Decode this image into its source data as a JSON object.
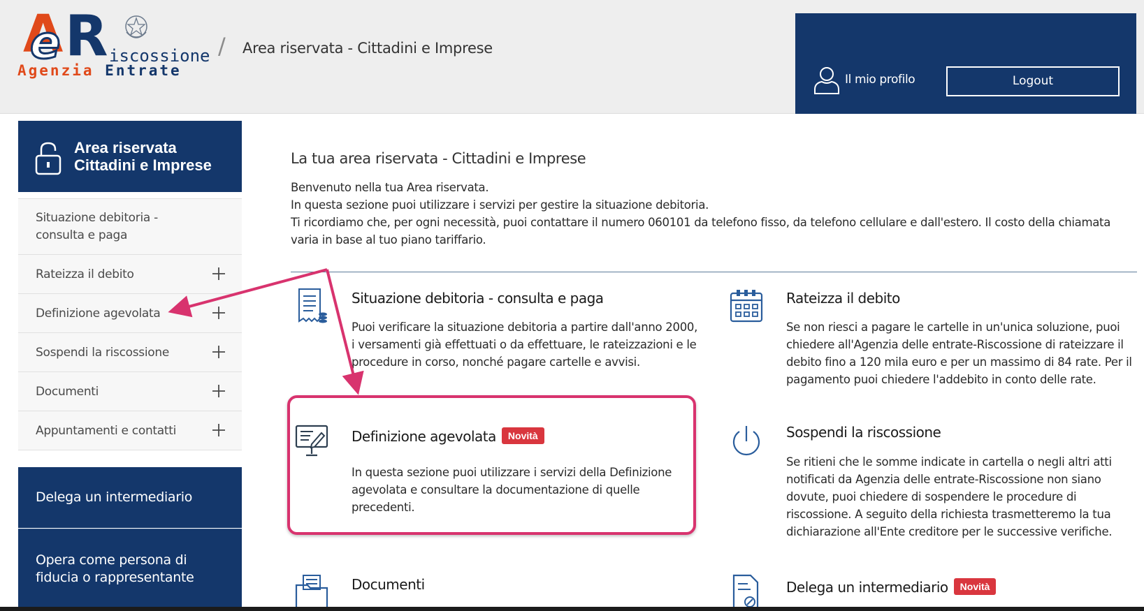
{
  "header": {
    "logo": {
      "mark_letters": "eR",
      "suffix": "iscossione",
      "agency_word1": "Agenzia",
      "agency_word2": "Entrate",
      "emblem_icon": "italian-republic-emblem"
    },
    "breadcrumb_separator": "/",
    "breadcrumb_title": "Area riservata - Cittadini e Imprese",
    "profile_label": "Il mio profilo",
    "profile_icon": "user-icon",
    "logout_label": "Logout"
  },
  "sidebar": {
    "header_title_line1": "Area riservata",
    "header_title_line2": "Cittadini e Imprese",
    "header_icon": "lock-open-icon",
    "items": [
      {
        "label": "Situazione debitoria - consulta e paga",
        "expandable": false
      },
      {
        "label": "Rateizza il debito",
        "expandable": true
      },
      {
        "label": "Definizione agevolata",
        "expandable": true
      },
      {
        "label": "Sospendi la riscossione",
        "expandable": true
      },
      {
        "label": "Documenti",
        "expandable": true
      },
      {
        "label": "Appuntamenti e contatti",
        "expandable": true
      }
    ],
    "delegate_button": "Delega un intermediario",
    "trusted_person_button": "Opera come persona di fiducia o rappresentante"
  },
  "main": {
    "title": "La tua area riservata - Cittadini e Imprese",
    "intro": [
      "Benvenuto nella tua Area riservata.",
      "In questa sezione puoi utilizzare i servizi per gestire la situazione debitoria.",
      "Ti ricordiamo che, per ogni necessità, puoi contattare il numero 060101 da telefono fisso, da telefono cellulare e dall'estero. Il costo della chiamata varia in base al tuo piano tariffario."
    ],
    "cards": [
      {
        "title": "Situazione debitoria - consulta e paga",
        "icon": "receipt-icon",
        "badge": "",
        "desc": "Puoi verificare la situazione debitoria a partire dall'anno 2000, i versamenti già effettuati o da effettuare, le rateizzazioni e le procedure in corso, nonché pagare cartelle e avvisi."
      },
      {
        "title": "Rateizza il debito",
        "icon": "calendar-icon",
        "badge": "",
        "desc": "Se non riesci a pagare le cartelle in un'unica soluzione, puoi chiedere all'Agenzia delle entrate-Riscossione di rateizzare il debito fino a 120 mila euro e per un massimo di 84 rate. Per il pagamento puoi chiedere l'addebito in conto delle rate."
      },
      {
        "title": "Definizione agevolata",
        "icon": "monitor-edit-icon",
        "badge": "Novità",
        "desc": "In questa sezione puoi utilizzare i servizi della Definizione agevolata e consultare la documentazione di quelle precedenti."
      },
      {
        "title": "Sospendi la riscossione",
        "icon": "power-icon",
        "badge": "",
        "desc": "Se ritieni che le somme indicate in cartella o negli altri atti notificati da Agenzia delle entrate-Riscossione non siano dovute, puoi chiedere di sospendere le procedure di riscossione. A seguito della richiesta trasmetteremo la tua dichiarazione all'Ente creditore per le successive verifiche."
      },
      {
        "title": "Documenti",
        "icon": "folder-documents-icon",
        "badge": "",
        "desc": ""
      },
      {
        "title": "Delega un intermediario",
        "icon": "document-stamp-icon",
        "badge": "Novità",
        "desc": ""
      }
    ]
  },
  "annotations": {
    "color": "#d8336e",
    "highlight_target": "Definizione agevolata"
  },
  "colors": {
    "brand_navy": "#14376b",
    "brand_orange": "#e0491a",
    "badge_red": "#d9363e",
    "header_gray": "#eeeeee"
  }
}
